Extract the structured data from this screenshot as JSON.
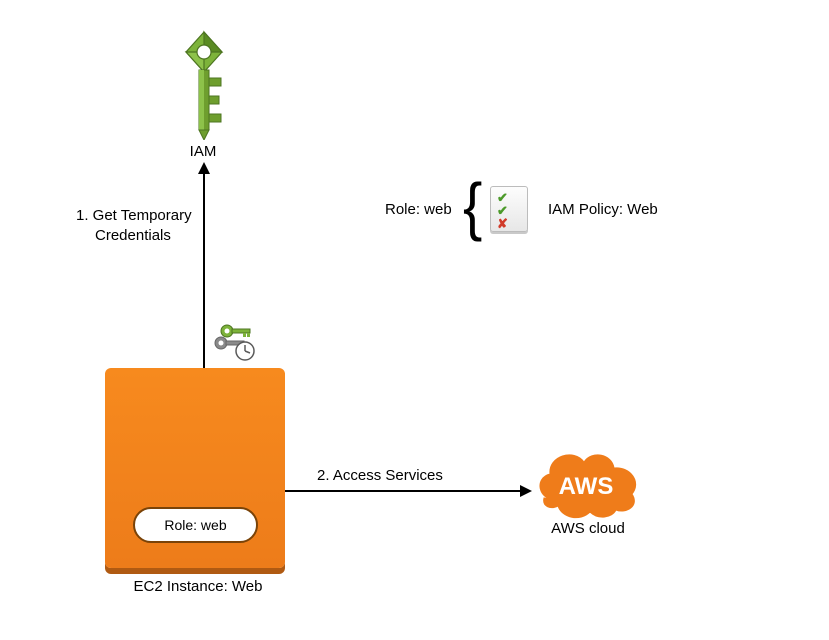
{
  "iam": {
    "label": "IAM"
  },
  "arrows": {
    "step1": {
      "text_line1": "1. Get Temporary",
      "text_line2": "Credentials"
    },
    "step2": {
      "text": "2. Access Services"
    }
  },
  "ec2": {
    "role_pill": "Role: web",
    "caption": "EC2 Instance: Web"
  },
  "policy": {
    "role_label": "Role: web",
    "policy_label": "IAM Policy: Web"
  },
  "aws": {
    "cloud_text": "AWS",
    "caption": "AWS cloud"
  }
}
